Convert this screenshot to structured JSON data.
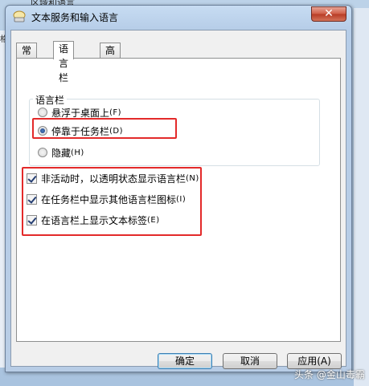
{
  "background": {
    "title": "区域和语言",
    "sidebar_tab": "格"
  },
  "dialog": {
    "title": "文本服务和输入语言",
    "close_label": "✕"
  },
  "tabs": [
    {
      "label": "常规",
      "active": false
    },
    {
      "label": "语言栏",
      "active": true
    },
    {
      "label": "高级键设置",
      "active": false
    }
  ],
  "language_bar": {
    "group_label": "语言栏",
    "options": [
      {
        "label": "悬浮于桌面上",
        "shortcut": "(F)",
        "checked": false
      },
      {
        "label": "停靠于任务栏",
        "shortcut": "(D)",
        "checked": true
      },
      {
        "label": "隐藏",
        "shortcut": "(H)",
        "checked": false
      }
    ]
  },
  "checkboxes": [
    {
      "label": "非活动时，以透明状态显示语言栏",
      "shortcut": "(N)",
      "checked": true
    },
    {
      "label": "在任务栏中显示其他语言栏图标",
      "shortcut": "(I)",
      "checked": true
    },
    {
      "label": "在语言栏上显示文本标签",
      "shortcut": "(E)",
      "checked": true
    }
  ],
  "buttons": {
    "ok": "确定",
    "cancel": "取消",
    "apply": "应用(A)"
  },
  "watermark": "头条 @金山毒霸",
  "colors": {
    "highlight_box": "#e32a2a",
    "title_bar": "#b6cde8"
  }
}
